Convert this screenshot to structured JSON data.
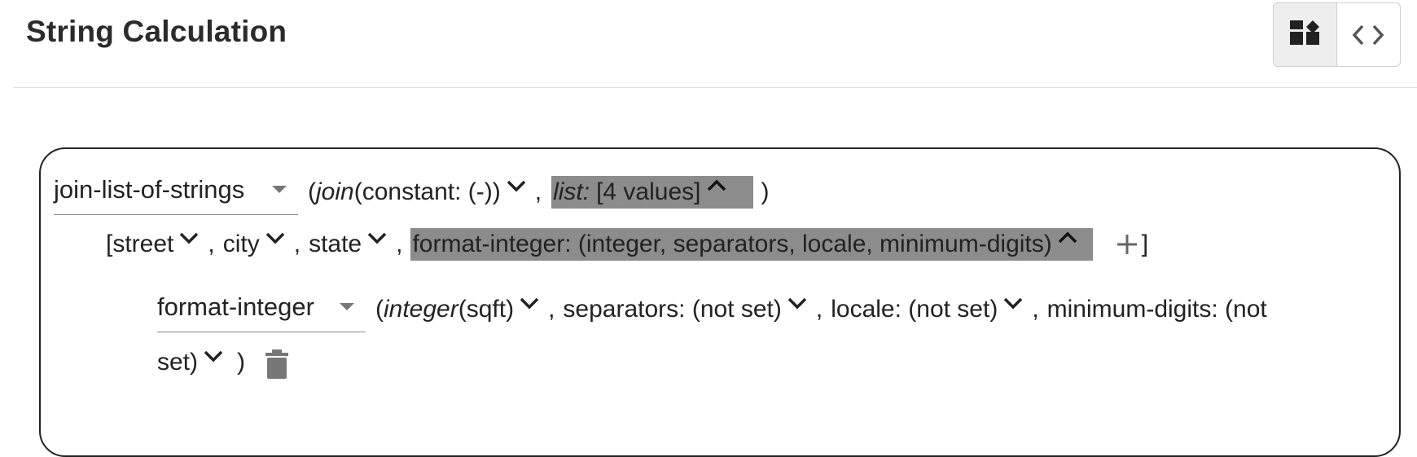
{
  "header": {
    "title": "String Calculation",
    "view_modes": [
      {
        "name": "blocks",
        "icon": "blocks-view-icon",
        "active": true
      },
      {
        "name": "code",
        "icon": "code-view-icon",
        "active": false
      }
    ]
  },
  "expr": {
    "root_function": "join-list-of-strings",
    "join_label": "join",
    "join_value": "(constant: (-))",
    "list_label": "list:",
    "list_value": "[4 values]",
    "list_open": "[",
    "list_close": "]",
    "items": [
      "street",
      "city",
      "state"
    ],
    "format_item": "format-integer: (integer, separators, locale, minimum-digits)",
    "inner_function": "format-integer",
    "integer_label": "integer",
    "integer_value": "(sqft)",
    "separators": "separators: (not set)",
    "locale": "locale: (not set)",
    "minimum_digits_a": "minimum-digits: (not",
    "minimum_digits_b": "set)",
    "comma": ",",
    "paren_open": "(",
    "paren_close": ")"
  },
  "colors": {
    "highlight": "#8c8c8c",
    "border": "#222222",
    "divider": "#dedede"
  }
}
